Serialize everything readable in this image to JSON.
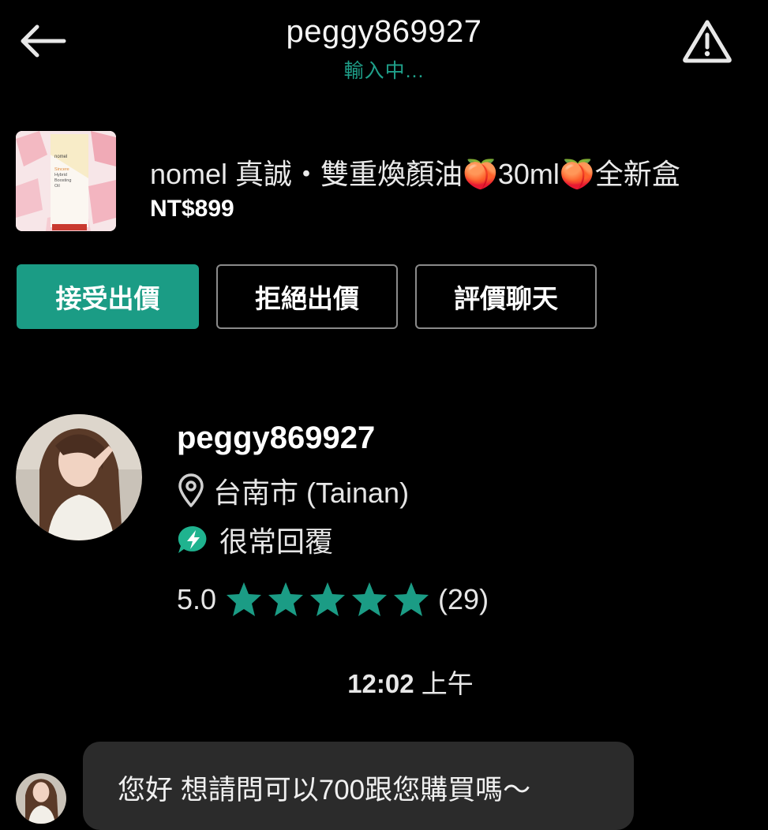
{
  "header": {
    "title": "peggy869927",
    "status": "輸入中..."
  },
  "product": {
    "name": "nomel 真誠・雙重煥顏油🍑30ml🍑全新盒",
    "price": "NT$899",
    "thumb_brand": "nomel",
    "thumb_lines": [
      "Sincere",
      "Hybrid",
      "Boosting",
      "Oil"
    ]
  },
  "actions": {
    "accept_label": "接受出價",
    "reject_label": "拒絕出價",
    "review_label": "評價聊天"
  },
  "seller": {
    "name": "peggy869927",
    "location": "台南市 (Tainan)",
    "reply_badge": "很常回覆",
    "rating": "5.0",
    "stars": 5,
    "review_count": "(29)"
  },
  "chat": {
    "time": "12:02",
    "period": "上午",
    "messages": [
      {
        "text": "您好 想請問可以700跟您購買嗎～"
      }
    ]
  },
  "colors": {
    "accent": "#1b9c85",
    "status_text": "#1fa08a",
    "background": "#000000",
    "bubble": "#2b2b2b"
  },
  "icons": {
    "back": "arrow-left-icon",
    "report": "warning-triangle-icon",
    "location": "location-pin-icon",
    "reply": "lightning-chat-icon",
    "star": "star-icon"
  }
}
